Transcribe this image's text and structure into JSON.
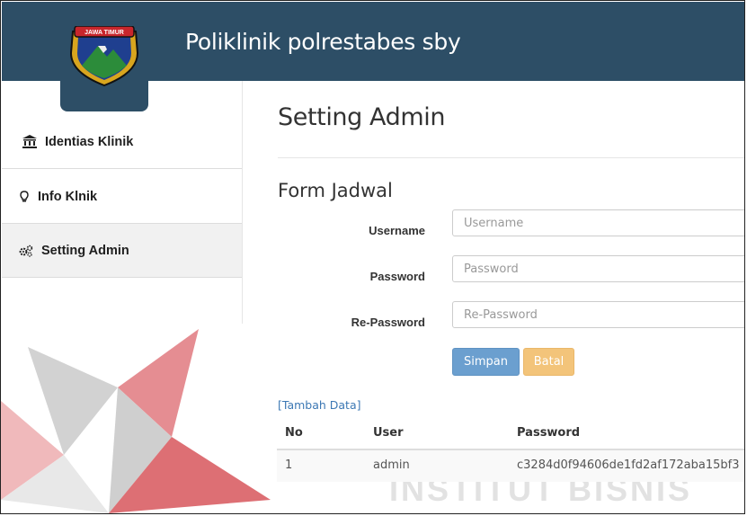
{
  "header": {
    "title": "Poliklinik polrestabes sby",
    "logo_text": "JAWA TIMUR"
  },
  "sidebar": {
    "items": [
      {
        "label": "Identias Klinik",
        "icon": "bank-icon"
      },
      {
        "label": "Info Klnik",
        "icon": "lightbulb-icon"
      },
      {
        "label": "Setting Admin",
        "icon": "gears-icon",
        "active": true
      }
    ]
  },
  "main": {
    "page_title": "Setting Admin",
    "form_title": "Form Jadwal",
    "fields": [
      {
        "label": "Username",
        "placeholder": "Username"
      },
      {
        "label": "Password",
        "placeholder": "Password"
      },
      {
        "label": "Re-Password",
        "placeholder": "Re-Password"
      }
    ],
    "buttons": {
      "save": "Simpan",
      "cancel": "Batal"
    },
    "add_link": "[Tambah Data]",
    "table": {
      "headers": [
        "No",
        "User",
        "Password"
      ],
      "rows": [
        {
          "no": "1",
          "user": "admin",
          "password": "c3284d0f94606de1fd2af172aba15bf3"
        }
      ]
    }
  },
  "watermark": {
    "text": "INSTITUT BISNIS"
  },
  "colors": {
    "topbar": "#2d4e66",
    "primary_button": "#6b9fcf",
    "warning_button": "#f3c47a",
    "link": "#3c78b4",
    "watermark_red": "#d9545a"
  }
}
